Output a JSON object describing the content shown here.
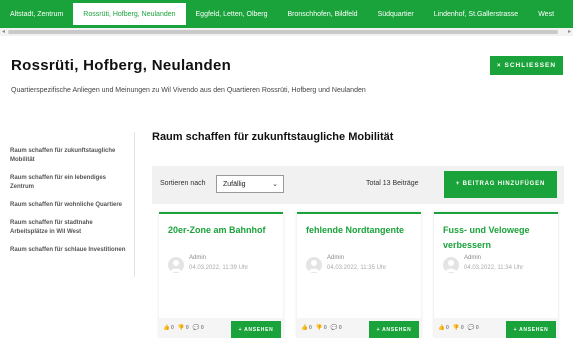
{
  "tabs": [
    {
      "label": "Altstadt, Zentrum"
    },
    {
      "label": "Rossrüti, Hofberg, Neulanden",
      "active": true
    },
    {
      "label": "Eggfeld, Letten, Olberg"
    },
    {
      "label": "Bronschhofen, Bildfeld"
    },
    {
      "label": "Südquartier"
    },
    {
      "label": "Lindenhof, St.Gallerstrasse"
    },
    {
      "label": "West"
    }
  ],
  "header": {
    "title": "Rossrüti, Hofberg, Neulanden",
    "close_label": "× SCHLIESSEN",
    "description": "Quartierspezifische Anliegen und Meinungen zu Wil Vivendo aus den Quartieren Rossrüti, Hofberg und Neulanden"
  },
  "sidebar": {
    "items": [
      {
        "label": "Raum schaffen für zukunftstaugliche Mobilität"
      },
      {
        "label": "Raum schaffen für ein lebendiges Zentrum"
      },
      {
        "label": "Raum schaffen für wohnliche Quartiere"
      },
      {
        "label": "Raum schaffen für stadtnahe Arbeitsplätze in Wil West"
      },
      {
        "label": "Raum schaffen für schlaue Investitionen"
      }
    ]
  },
  "main": {
    "section_title": "Raum schaffen für zukunftstaugliche Mobilität",
    "sort_label": "Sortieren nach",
    "sort_value": "Zufällig",
    "total": "Total 13 Beiträge",
    "add_label": "+ BEITRAG HINZUFÜGEN"
  },
  "cards": [
    {
      "title": "20er-Zone am Bahnhof",
      "author": "Admin",
      "date": "04.03.2022, 11:39 Uhr",
      "likes": "0",
      "dislikes": "0",
      "comments": "0",
      "button": "+ ANSEHEN"
    },
    {
      "title": "fehlende Nordtangente",
      "author": "Admin",
      "date": "04.03.2022, 11:35 Uhr",
      "likes": "0",
      "dislikes": "0",
      "comments": "0",
      "button": "+ ANSEHEN"
    },
    {
      "title": "Fuss- und Velowege verbessern",
      "author": "Admin",
      "date": "04.03.2022, 11:34 Uhr",
      "likes": "0",
      "dislikes": "0",
      "comments": "0",
      "button": "+ ANSEHEN"
    }
  ],
  "colors": {
    "accent": "#1aa33a",
    "toolbar_bg": "#f1f1f1"
  }
}
